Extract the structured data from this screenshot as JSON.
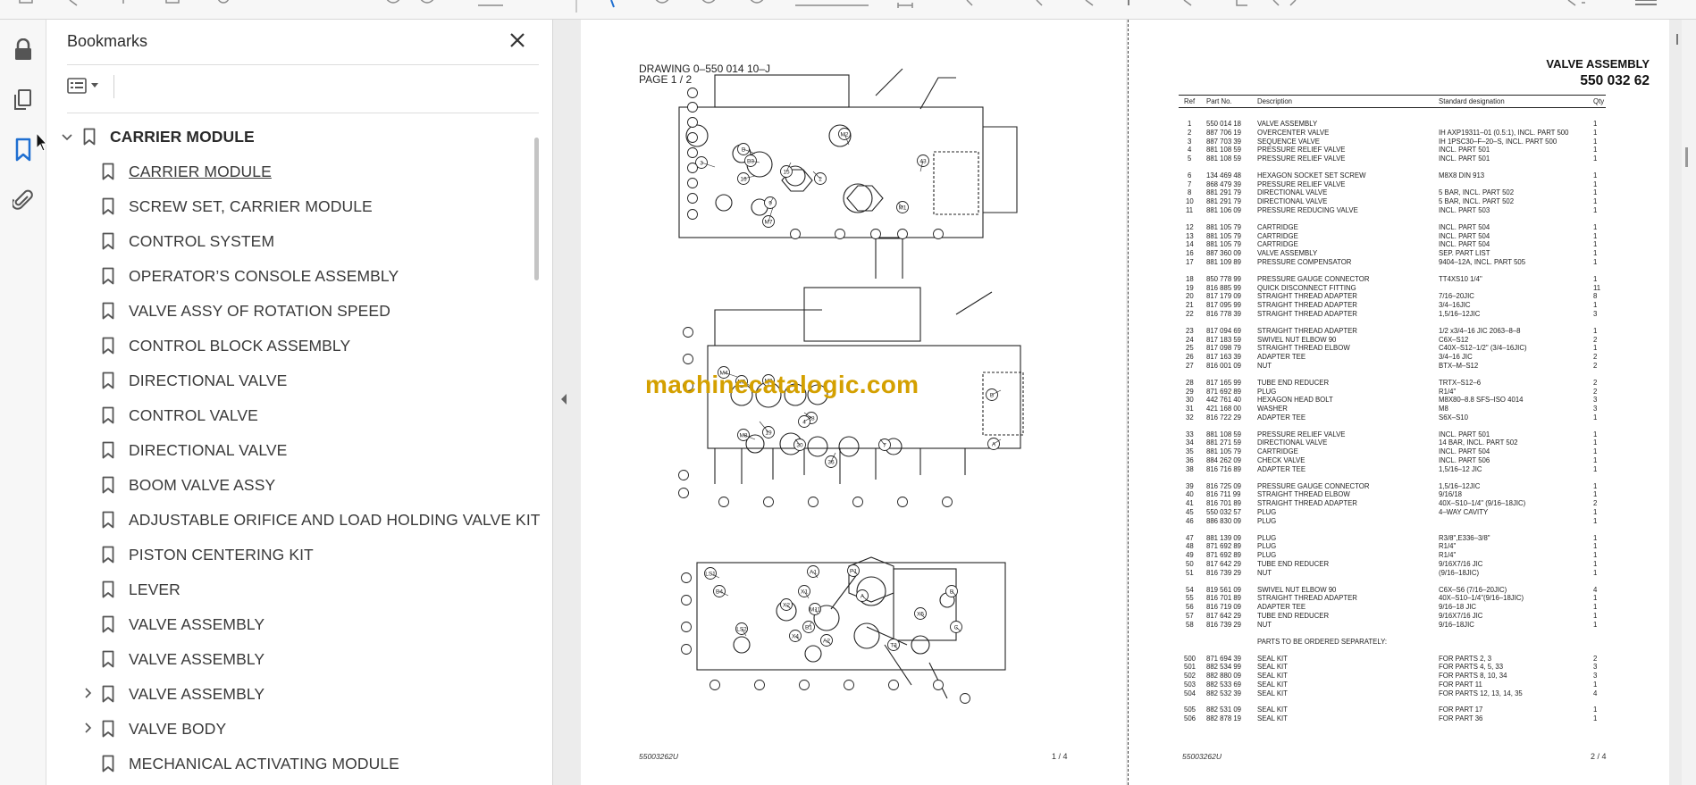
{
  "sidebar_panel": {
    "title": "Bookmarks",
    "close_icon": "close-icon",
    "options_icon": "list-options-icon"
  },
  "rail": [
    {
      "name": "lock-icon",
      "active": false
    },
    {
      "name": "page-thumbnails-icon",
      "active": false
    },
    {
      "name": "bookmark-icon",
      "active": true
    },
    {
      "name": "paperclip-icon",
      "active": false
    }
  ],
  "bookmarks": {
    "root": "CARRIER MODULE",
    "items": [
      {
        "label": "CARRIER MODULE",
        "selected": true,
        "expandable": false
      },
      {
        "label": "SCREW SET, CARRIER MODULE",
        "selected": false,
        "expandable": false
      },
      {
        "label": "CONTROL SYSTEM",
        "selected": false,
        "expandable": false
      },
      {
        "label": "OPERATOR’S CONSOLE ASSEMBLY",
        "selected": false,
        "expandable": false
      },
      {
        "label": "VALVE ASSY OF ROTATION SPEED",
        "selected": false,
        "expandable": false
      },
      {
        "label": "CONTROL BLOCK ASSEMBLY",
        "selected": false,
        "expandable": false
      },
      {
        "label": "DIRECTIONAL VALVE",
        "selected": false,
        "expandable": false
      },
      {
        "label": "CONTROL VALVE",
        "selected": false,
        "expandable": false
      },
      {
        "label": "DIRECTIONAL VALVE",
        "selected": false,
        "expandable": false
      },
      {
        "label": "BOOM VALVE ASSY",
        "selected": false,
        "expandable": false
      },
      {
        "label": "ADJUSTABLE ORIFICE AND LOAD HOLDING VALVE KIT",
        "selected": false,
        "expandable": false
      },
      {
        "label": "PISTON CENTERING KIT",
        "selected": false,
        "expandable": false
      },
      {
        "label": "LEVER",
        "selected": false,
        "expandable": false
      },
      {
        "label": "VALVE ASSEMBLY",
        "selected": false,
        "expandable": false
      },
      {
        "label": "VALVE ASSEMBLY",
        "selected": false,
        "expandable": false
      },
      {
        "label": "VALVE ASSEMBLY",
        "selected": false,
        "expandable": true
      },
      {
        "label": "VALVE BODY",
        "selected": false,
        "expandable": true
      },
      {
        "label": "MECHANICAL ACTIVATING MODULE",
        "selected": false,
        "expandable": false
      }
    ]
  },
  "page_left": {
    "drawing": "DRAWING 0–550 014 10–J",
    "page_ref": "PAGE 1 / 2",
    "footer_code": "55003262U",
    "page_num": "1 /  4",
    "callouts_top": [
      "2",
      "15",
      "43",
      "3",
      "16",
      "9",
      "M2",
      "M1",
      "M7",
      "B",
      "B3"
    ],
    "callouts_mid": [
      "M3",
      "28",
      "19",
      "30",
      "7",
      "4",
      "M8",
      "M4",
      "M5",
      "B",
      "A",
      "36"
    ],
    "callouts_bot": [
      "LS1",
      "LS2",
      "B4",
      "A1",
      "X1",
      "X2",
      "X4",
      "M11",
      "A2",
      "B1",
      "X5",
      "T3",
      "P1",
      "A",
      "B",
      "C"
    ]
  },
  "page_right": {
    "title": "VALVE ASSEMBLY",
    "part_number": "550 032 62",
    "headers": {
      "ref": "Ref",
      "part": "Part No.",
      "desc": "Description",
      "std": "Standard designation",
      "qty": "Qty"
    },
    "groups": [
      [
        [
          "1",
          "550 014 18",
          "VALVE ASSEMBLY",
          "",
          "1"
        ],
        [
          "2",
          "887 706 19",
          "OVERCENTER VALVE",
          "IH AXP19311–01 (0.5:1), INCL. PART 500",
          "1"
        ],
        [
          "3",
          "887 703 39",
          "SEQUENCE VALVE",
          "IH 1PSC30–F–20–S, INCL. PART 500",
          "1"
        ],
        [
          "4",
          "881 108 59",
          "PRESSURE RELIEF VALVE",
          "INCL. PART 501",
          "1"
        ],
        [
          "5",
          "881 108 59",
          "PRESSURE RELIEF VALVE",
          "INCL. PART 501",
          "1"
        ]
      ],
      [
        [
          "6",
          "134 469 48",
          "HEXAGON SOCKET SET SCREW",
          "M8X8 DIN 913",
          "1"
        ],
        [
          "7",
          "868 479 39",
          "PRESSURE RELIEF VALVE",
          "",
          "1"
        ],
        [
          "8",
          "881 291 79",
          "DIRECTIONAL VALVE",
          "5 BAR, INCL. PART 502",
          "1"
        ],
        [
          "10",
          "881 291 79",
          "DIRECTIONAL VALVE",
          "5 BAR, INCL. PART 502",
          "1"
        ],
        [
          "11",
          "881 106 09",
          "PRESSURE REDUCING VALVE",
          "INCL. PART 503",
          "1"
        ]
      ],
      [
        [
          "12",
          "881 105 79",
          "CARTRIDGE",
          "INCL. PART 504",
          "1"
        ],
        [
          "13",
          "881 105 79",
          "CARTRIDGE",
          "INCL. PART 504",
          "1"
        ],
        [
          "14",
          "881 105 79",
          "CARTRIDGE",
          "INCL. PART 504",
          "1"
        ],
        [
          "16",
          "887 360 09",
          "VALVE ASSEMBLY",
          "SEP. PART LIST",
          "1"
        ],
        [
          "17",
          "881 109 89",
          "PRESSURE COMPENSATOR",
          "9404–12A, INCL. PART 505",
          "1"
        ]
      ],
      [
        [
          "18",
          "850 778 99",
          "PRESSURE GAUGE CONNECTOR",
          "TT4XS10 1/4\"",
          "1"
        ],
        [
          "19",
          "816 885 99",
          "QUICK DISCONNECT FITTING",
          "",
          "11"
        ],
        [
          "20",
          "817 179 09",
          "STRAIGHT THREAD ADAPTER",
          "7/16–20JIC",
          "8"
        ],
        [
          "21",
          "817 095 99",
          "STRAIGHT THREAD ADAPTER",
          "3/4–16JIC",
          "1"
        ],
        [
          "22",
          "816 778 39",
          "STRAIGHT THREAD ADAPTER",
          "1,5/16–12JIC",
          "3"
        ]
      ],
      [
        [
          "23",
          "817 094 69",
          "STRAIGHT THREAD ADAPTER",
          "1/2 x3/4–16 JIC 2063–8–8",
          "1"
        ],
        [
          "24",
          "817 183 59",
          "SWIVEL NUT ELBOW 90",
          "C6X–S12",
          "2"
        ],
        [
          "25",
          "817 098 79",
          "STRAIGHT THREAD ELBOW",
          "C40X–S12–1/2\" (3/4–16JIC)",
          "1"
        ],
        [
          "26",
          "817 163 39",
          "ADAPTER TEE",
          "3/4–16 JIC",
          "2"
        ],
        [
          "27",
          "816 001 09",
          "NUT",
          "BTX–M–S12",
          "2"
        ]
      ],
      [
        [
          "28",
          "817 165 99",
          "TUBE END REDUCER",
          "TRTX–S12–6",
          "2"
        ],
        [
          "29",
          "871 692 89",
          "PLUG",
          "R1/4\"",
          "2"
        ],
        [
          "30",
          "442 761 40",
          "HEXAGON HEAD BOLT",
          "M8X80–8.8 SFS–ISO 4014",
          "3"
        ],
        [
          "31",
          "421 168 00",
          "WASHER",
          "M8",
          "3"
        ],
        [
          "32",
          "816 722 29",
          "ADAPTER TEE",
          "S6X–S10",
          "1"
        ]
      ],
      [
        [
          "33",
          "881 108 59",
          "PRESSURE RELIEF VALVE",
          "INCL. PART 501",
          "1"
        ],
        [
          "34",
          "881 271 59",
          "DIRECTIONAL VALVE",
          "14 BAR, INCL. PART 502",
          "1"
        ],
        [
          "35",
          "881 105 79",
          "CARTRIDGE",
          "INCL. PART 504",
          "1"
        ],
        [
          "36",
          "884 262 09",
          "CHECK VALVE",
          "INCL. PART 506",
          "1"
        ],
        [
          "38",
          "816 716 89",
          "ADAPTER TEE",
          "1,5/16–12 JIC",
          "1"
        ]
      ],
      [
        [
          "39",
          "816 725 09",
          "PRESSURE GAUGE CONNECTOR",
          "1,5/16–12JIC",
          "1"
        ],
        [
          "40",
          "816 711 99",
          "STRAIGHT THREAD ELBOW",
          "9/16/18",
          "1"
        ],
        [
          "41",
          "816 701 89",
          "STRAIGHT THREAD ADAPTER",
          "40X–S10–1/4\" (9/16–18JIC)",
          "2"
        ],
        [
          "45",
          "550 032 57",
          "PLUG",
          "4–WAY CAVITY",
          "1"
        ],
        [
          "46",
          "886 830 09",
          "PLUG",
          "",
          "1"
        ]
      ],
      [
        [
          "47",
          "881 139 09",
          "PLUG",
          "R3/8\",E336–3/8\"",
          "1"
        ],
        [
          "48",
          "871 692 89",
          "PLUG",
          "R1/4\"",
          "1"
        ],
        [
          "49",
          "871 692 89",
          "PLUG",
          "R1/4\"",
          "1"
        ],
        [
          "50",
          "817 642 29",
          "TUBE END REDUCER",
          "9/16X7/16 JIC",
          "1"
        ],
        [
          "51",
          "816 739 29",
          "NUT",
          "(9/16–18JIC)",
          "1"
        ]
      ],
      [
        [
          "54",
          "819 561 09",
          "SWIVEL NUT ELBOW 90",
          "C6X–S6 (7/16–20JIC)",
          "4"
        ],
        [
          "55",
          "816 701 89",
          "STRAIGHT THREAD ADAPTER",
          "40X–S10–1/4\"(9/16–18JIC)",
          "1"
        ],
        [
          "56",
          "816 719 09",
          "ADAPTER TEE",
          "9/16–18 JIC",
          "1"
        ],
        [
          "57",
          "817 642 29",
          "TUBE END REDUCER",
          "9/16X7/16 JIC",
          "1"
        ],
        [
          "58",
          "816 739 29",
          "NUT",
          "9/16–18JIC",
          "1"
        ]
      ]
    ],
    "separately_note": "PARTS TO BE ORDERED SEPARATELY:",
    "seal_groups": [
      [
        [
          "500",
          "871 694 39",
          "SEAL KIT",
          "FOR PARTS 2, 3",
          "2"
        ],
        [
          "501",
          "882 534 99",
          "SEAL KIT",
          "FOR PARTS 4, 5, 33",
          "3"
        ],
        [
          "502",
          "882 880 09",
          "SEAL KIT",
          "FOR PARTS 8, 10, 34",
          "3"
        ],
        [
          "503",
          "882 533 69",
          "SEAL KIT",
          "FOR PART 11",
          "1"
        ],
        [
          "504",
          "882 532 39",
          "SEAL KIT",
          "FOR PARTS 12, 13, 14, 35",
          "4"
        ]
      ],
      [
        [
          "505",
          "882 531 09",
          "SEAL KIT",
          "FOR PART 17",
          "1"
        ],
        [
          "506",
          "882 878 19",
          "SEAL KIT",
          "FOR PART 36",
          "1"
        ]
      ]
    ],
    "footer_code": "55003262U",
    "page_num": "2 /  4"
  },
  "watermark": "machinecatalogic.com",
  "colors": {
    "accent": "#1f6fd1",
    "watermark": "#d4a000",
    "panel_bg": "#ffffff",
    "doc_bg": "#ececec"
  }
}
